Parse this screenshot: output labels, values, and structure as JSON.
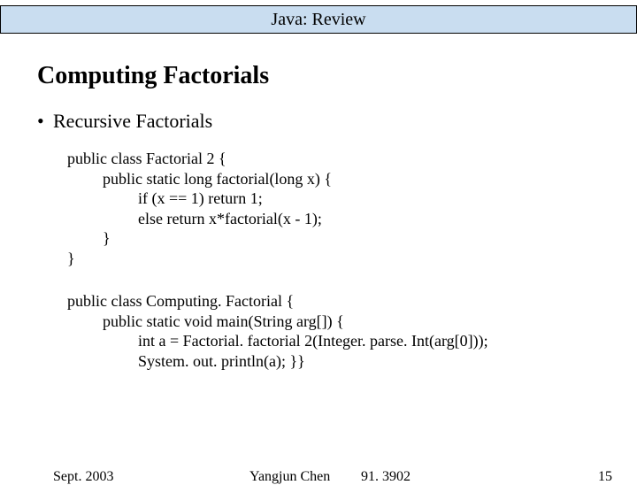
{
  "header": {
    "title": "Java: Review"
  },
  "heading": "Computing Factorials",
  "bullet": {
    "dot": "•",
    "text": "Recursive Factorials"
  },
  "code1": {
    "l1": "public class Factorial 2 {",
    "l2": "public static long factorial(long x) {",
    "l3": "if  (x == 1) return 1;",
    "l4": "else return x*factorial(x - 1);",
    "l5": "}",
    "l6": "}"
  },
  "code2": {
    "l1": "public class Computing. Factorial {",
    "l2": "public static void main(String arg[]) {",
    "l3": "int a = Factorial. factorial 2(Integer. parse. Int(arg[0]));",
    "l4": "System. out. println(a); }}"
  },
  "footer": {
    "date": "Sept. 2003",
    "author": "Yangjun Chen",
    "course": "91. 3902",
    "page": "15"
  }
}
